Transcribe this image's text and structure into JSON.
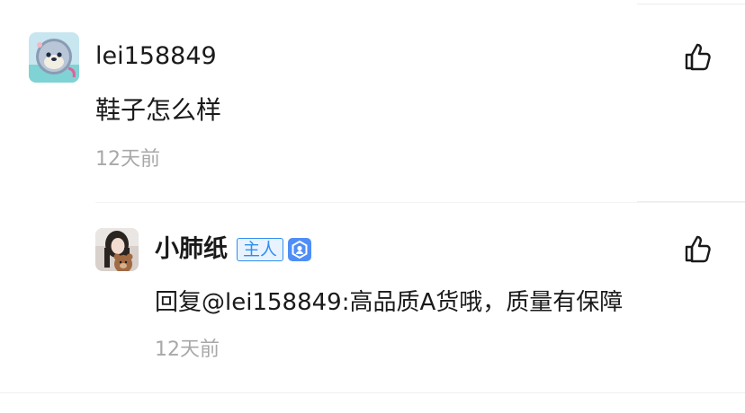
{
  "comments": [
    {
      "username": "lei158849",
      "text": "鞋子怎么样",
      "time": "12天前",
      "like_icon": "thumbs-up-icon"
    }
  ],
  "reply": {
    "username": "小肺纸",
    "owner_badge": "主人",
    "verified_icon": "verified-user-icon",
    "text": "回复@lei158849:高品质A货哦，质量有保障",
    "time": "12天前",
    "like_icon": "thumbs-up-icon"
  },
  "colors": {
    "text_primary": "#1a1a1a",
    "text_muted": "#a8a8a8",
    "badge_blue": "#2f8ff0",
    "divider": "#ededed"
  }
}
